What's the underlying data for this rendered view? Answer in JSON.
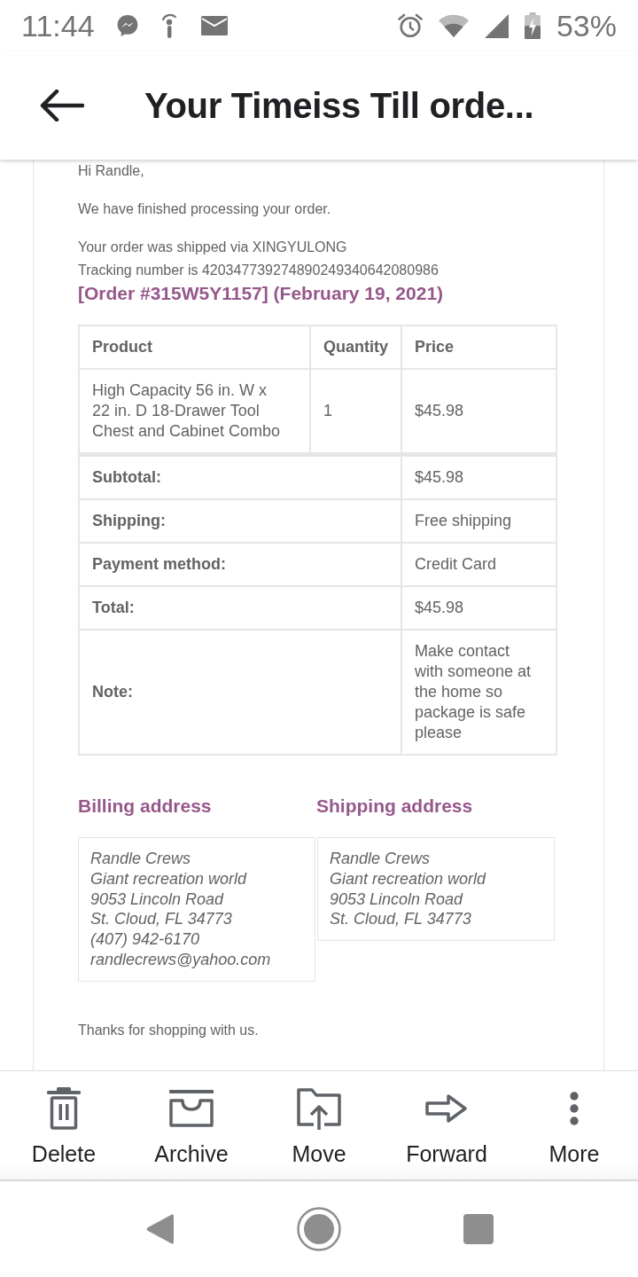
{
  "status_bar": {
    "time": "11:44",
    "battery": "53%"
  },
  "app_bar": {
    "title": "Your Timeiss Till orde..."
  },
  "email": {
    "greeting": "Hi Randle,",
    "intro": "We have finished processing your order.",
    "shipping_lines": [
      "Your order was shipped via XINGYULONG",
      "Tracking number is 420347739274890249340642080986"
    ],
    "order_heading": "[Order #315W5Y1157] (February 19, 2021)",
    "order_table": {
      "columns": [
        "Product",
        "Quantity",
        "Price"
      ],
      "rows": [
        {
          "product": "High Capacity 56 in. W x 22 in. D 18-Drawer Tool Chest and Cabinet Combo",
          "quantity": "1",
          "price": "$45.98"
        }
      ],
      "totals": [
        {
          "label": "Subtotal:",
          "value": "$45.98"
        },
        {
          "label": "Shipping:",
          "value": "Free shipping"
        },
        {
          "label": "Payment method:",
          "value": "Credit Card"
        },
        {
          "label": "Total:",
          "value": "$45.98"
        },
        {
          "label": "Note:",
          "value": "Make contact with someone at the home so package is safe please"
        }
      ]
    },
    "addresses": [
      {
        "heading": "Billing address",
        "lines": [
          "Randle Crews",
          "Giant recreation world",
          "9053 Lincoln Road",
          "St. Cloud, FL 34773",
          "(407) 942-6170",
          "randlecrews@yahoo.com"
        ]
      },
      {
        "heading": "Shipping address",
        "lines": [
          "Randle Crews",
          "Giant recreation world",
          "9053 Lincoln Road",
          "St. Cloud, FL 34773"
        ]
      }
    ],
    "closing": "Thanks for shopping with us."
  },
  "toolbar": {
    "actions": [
      {
        "kind": "delete",
        "label": "Delete"
      },
      {
        "kind": "archive",
        "label": "Archive"
      },
      {
        "kind": "move",
        "label": "Move"
      },
      {
        "kind": "forward",
        "label": "Forward"
      },
      {
        "kind": "more",
        "label": "More"
      }
    ]
  }
}
